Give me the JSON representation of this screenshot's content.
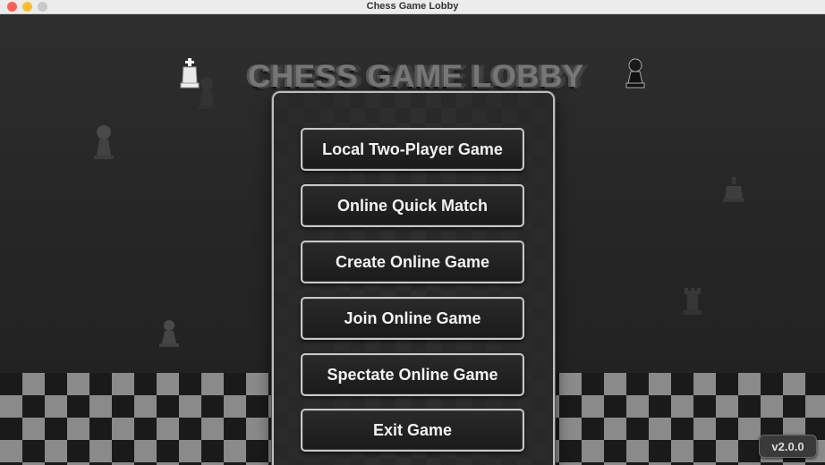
{
  "window": {
    "title": "Chess Game Lobby"
  },
  "header": {
    "title": "CHESS GAME LOBBY"
  },
  "menu": {
    "buttons": [
      {
        "id": "local-two-player",
        "label": "Local Two-Player Game"
      },
      {
        "id": "online-quick-match",
        "label": "Online Quick Match"
      },
      {
        "id": "create-online-game",
        "label": "Create Online Game"
      },
      {
        "id": "join-online-game",
        "label": "Join Online Game"
      },
      {
        "id": "spectate-online-game",
        "label": "Spectate Online Game"
      },
      {
        "id": "exit-game",
        "label": "Exit Game"
      }
    ]
  },
  "footer": {
    "version": "v2.0.0"
  },
  "icons": {
    "title_left": "white-king-icon",
    "title_right": "black-pawn-icon",
    "background": [
      "pawn-icon",
      "pawn-icon",
      "king-icon",
      "rook-icon"
    ]
  },
  "colors": {
    "background": "#262626",
    "button_border": "#c8c8c8",
    "button_text": "#f2f2f2",
    "checker_light": "#8a8a8a",
    "checker_dark": "#1a1a1a"
  }
}
